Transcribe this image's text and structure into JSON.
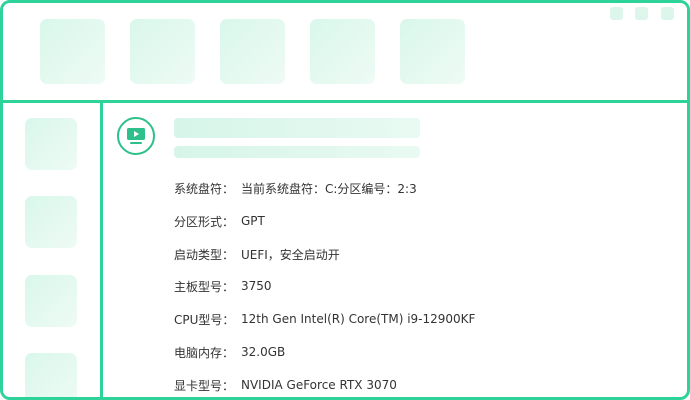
{
  "window": {
    "toolbar_tiles": [
      "placeholder",
      "placeholder",
      "placeholder",
      "placeholder",
      "placeholder"
    ],
    "window_buttons": [
      "minimize",
      "maximize",
      "close"
    ]
  },
  "sidebar": {
    "tiles": [
      "placeholder",
      "placeholder",
      "placeholder",
      "placeholder"
    ]
  },
  "main": {
    "icon": "monitor-play-icon",
    "accent_color": "#2ed39a",
    "info": [
      {
        "label": "系统盘符：",
        "value": "当前系统盘符：C:分区编号：2:3"
      },
      {
        "label": "分区形式：",
        "value": "GPT"
      },
      {
        "label": "启动类型：",
        "value": "UEFI，安全启动开"
      },
      {
        "label": "主板型号：",
        "value": "3750"
      },
      {
        "label": "CPU型号：",
        "value": "12th Gen Intel(R) Core(TM) i9-12900KF"
      },
      {
        "label": "电脑内存：",
        "value": "32.0GB"
      },
      {
        "label": "显卡型号：",
        "value": "NVIDIA GeForce RTX 3070"
      }
    ]
  }
}
